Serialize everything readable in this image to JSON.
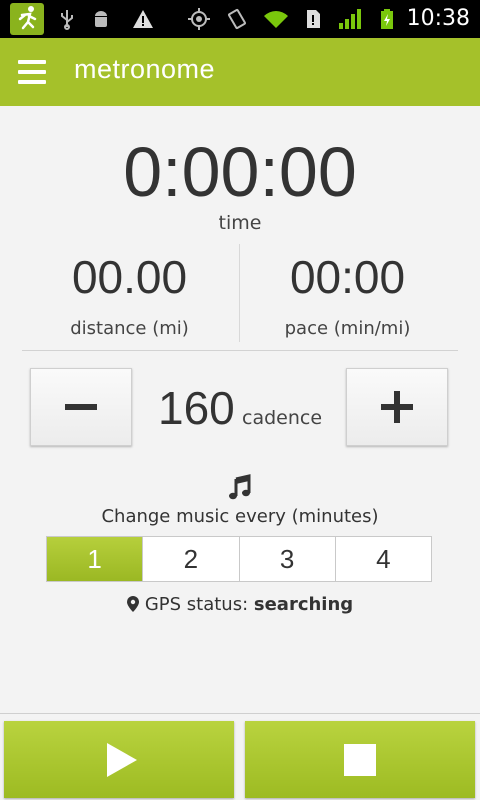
{
  "status_bar": {
    "time": "10:38",
    "icons": [
      "app-runner-icon",
      "usb-icon",
      "android-debug-icon",
      "warning-icon",
      "gps-icon",
      "rotation-icon",
      "wifi-icon",
      "sim-icon",
      "signal-icon",
      "battery-charging-icon"
    ]
  },
  "header": {
    "title": "metronome",
    "accent_color": "#a5c12a"
  },
  "stats": {
    "time_value": "0:00:00",
    "time_label": "time",
    "distance_value": "00.00",
    "distance_label": "distance (mi)",
    "pace_value": "00:00",
    "pace_label": "pace (min/mi)"
  },
  "cadence": {
    "value": "160",
    "label": "cadence"
  },
  "music": {
    "label": "Change music every (minutes)",
    "options": [
      "1",
      "2",
      "3",
      "4"
    ],
    "selected": "1"
  },
  "gps": {
    "prefix": "GPS status:",
    "status": "searching"
  }
}
